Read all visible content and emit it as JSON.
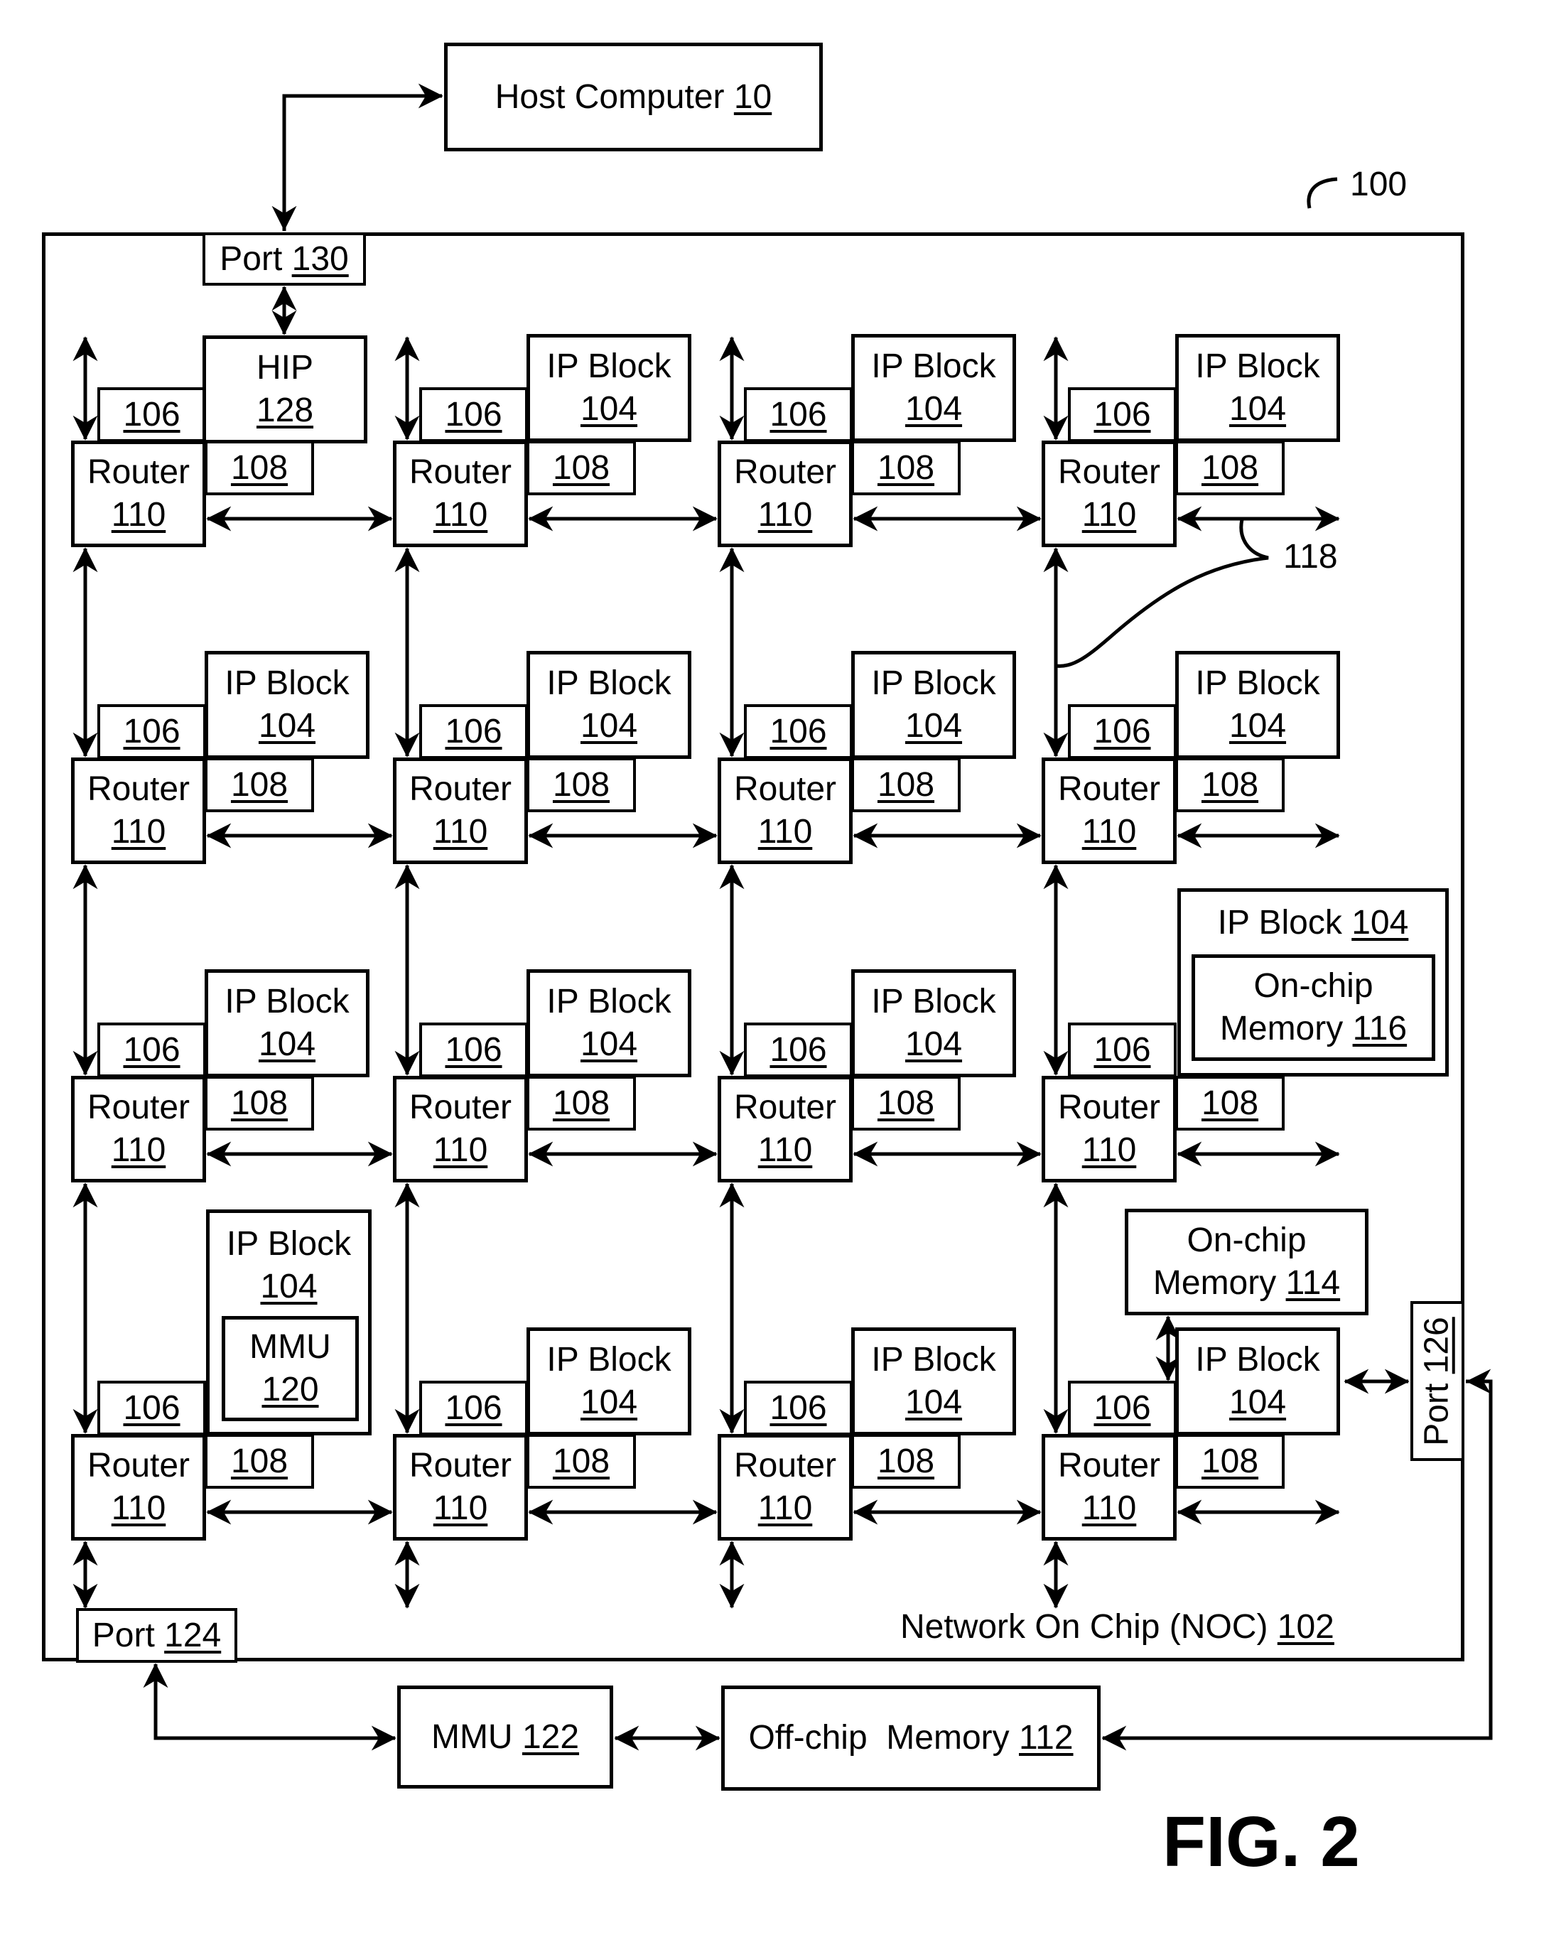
{
  "figure_label": "FIG. 2",
  "host": {
    "name": "Host Computer",
    "ref": "10"
  },
  "system_ref": "100",
  "link_ref": "118",
  "noc": {
    "name": "Network On Chip (NOC)",
    "ref": "102"
  },
  "ports": {
    "p130": {
      "name": "Port",
      "ref": "130"
    },
    "p124": {
      "name": "Port",
      "ref": "124"
    },
    "p126": {
      "name": "Port",
      "ref": "126"
    }
  },
  "hip": {
    "name": "HIP",
    "ref": "128"
  },
  "router": {
    "name": "Router",
    "ref": "110"
  },
  "ip_block": {
    "name": "IP Block",
    "ref": "104"
  },
  "memory_comm_ref": "106",
  "network_if_ref": "108",
  "mmu_inner": {
    "name": "MMU",
    "ref": "120"
  },
  "onchip_116": {
    "line1": "On-chip",
    "line2": "Memory",
    "ref": "116"
  },
  "onchip_114": {
    "line1": "On-chip",
    "line2": "Memory",
    "ref": "114"
  },
  "mmu_122": {
    "name": "MMU",
    "ref": "122"
  },
  "offchip": {
    "name": "Off-chip  Memory",
    "ref": "112"
  },
  "grid": {
    "rows": 4,
    "cols": 4
  }
}
